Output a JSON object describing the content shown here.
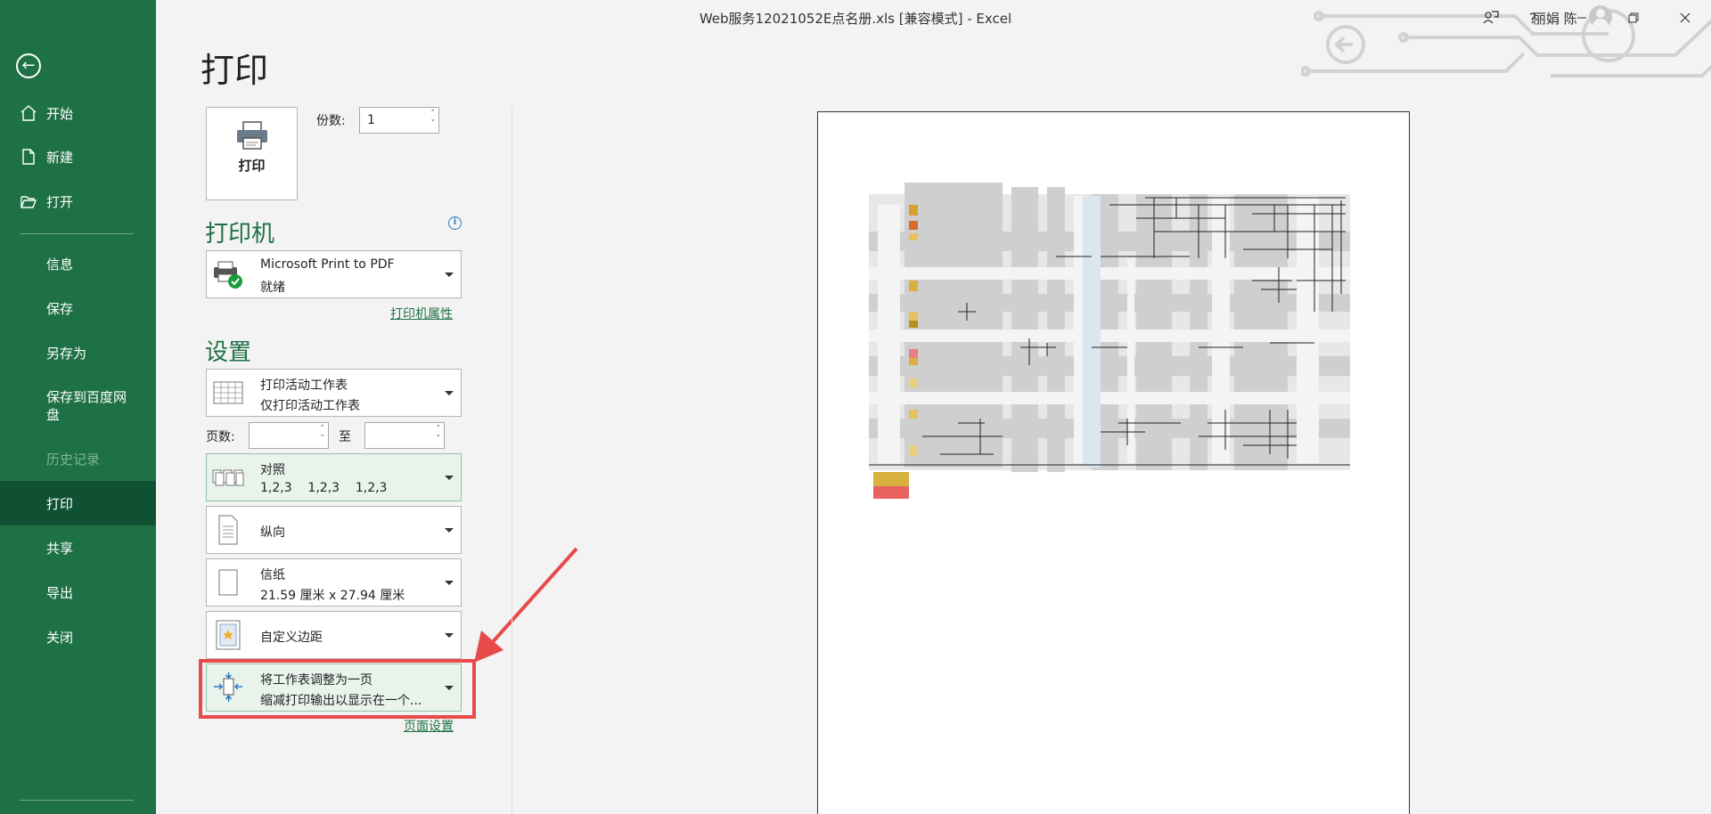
{
  "window": {
    "title": "Web服务12021052E点名册.xls  [兼容模式]  -  Excel",
    "user": "丽娟 陈",
    "help": "?"
  },
  "nav": {
    "back_label": "←",
    "items": [
      {
        "label": "开始"
      },
      {
        "label": "新建"
      },
      {
        "label": "打开"
      },
      {
        "label": "信息"
      },
      {
        "label": "保存"
      },
      {
        "label": "另存为"
      },
      {
        "label": "保存到百度网盘"
      },
      {
        "label": "历史记录"
      },
      {
        "label": "打印"
      },
      {
        "label": "共享"
      },
      {
        "label": "导出"
      },
      {
        "label": "关闭"
      }
    ]
  },
  "print": {
    "heading": "打印",
    "print_button_label": "打印",
    "copies_label": "份数:",
    "copies_value": "1",
    "printer_section": "打印机",
    "printer_name": "Microsoft Print to PDF",
    "printer_status": "就绪",
    "printer_properties_link": "打印机属性",
    "settings_section": "设置",
    "scope_line1": "打印活动工作表",
    "scope_line2": "仅打印活动工作表",
    "pages_label": "页数:",
    "to_label": "至",
    "collate_line1": "对照",
    "collate_line2": "1,2,3    1,2,3    1,2,3",
    "orientation": "纵向",
    "paper_line1": "信纸",
    "paper_line2": "21.59 厘米 x 27.94 厘米",
    "margins": "自定义边距",
    "scaling_line1": "将工作表调整为一页",
    "scaling_line2": "缩减打印输出以显示在一个...",
    "page_setup_link": "页面设置"
  },
  "colors": {
    "accent": "#1e7145",
    "nav_selected": "#0f5132",
    "highlight": "#e84a4a"
  }
}
